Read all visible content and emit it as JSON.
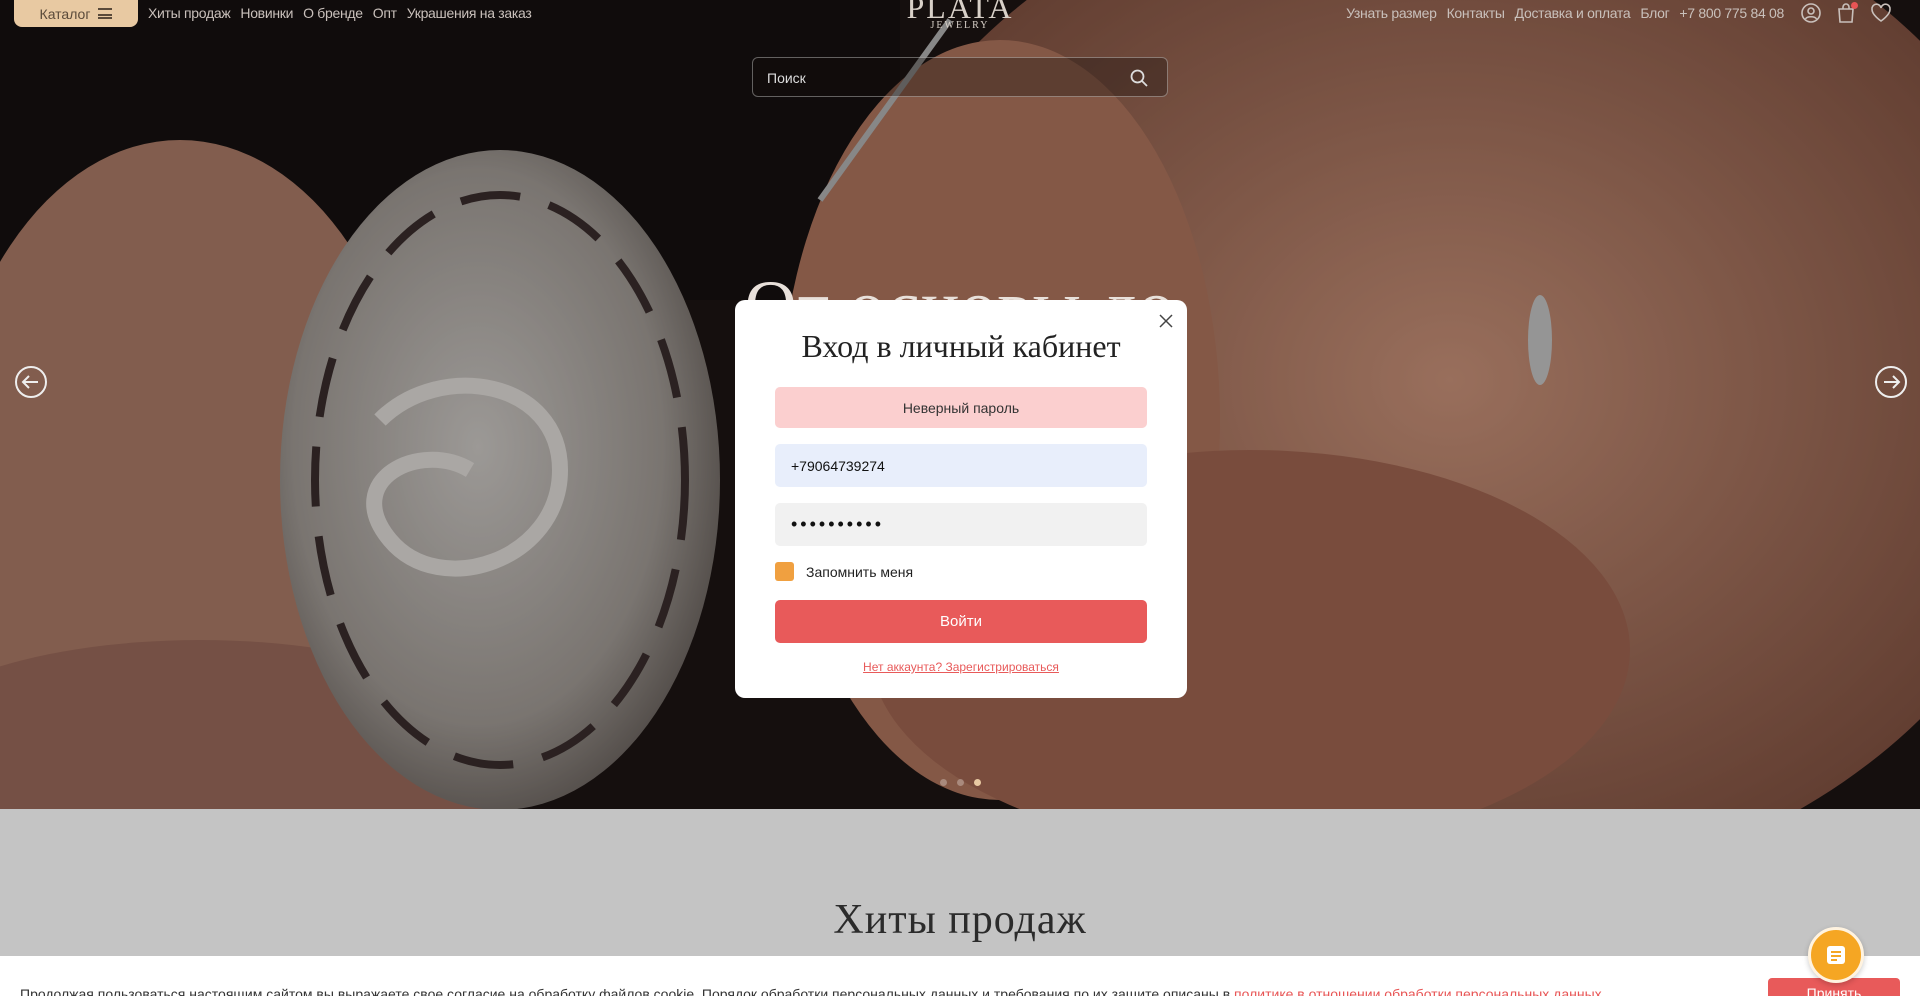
{
  "header": {
    "catalog_label": "Каталог",
    "nav_left": [
      "Хиты продаж",
      "Новинки",
      "О бренде",
      "Опт",
      "Украшения на заказ"
    ],
    "nav_right": [
      "Узнать размер",
      "Контакты",
      "Доставка и оплата",
      "Блог",
      "+7 800 775 84 08"
    ],
    "logo_main": "PLATA",
    "logo_sub": "JEWELRY",
    "icons": [
      "user-icon",
      "cart-icon",
      "heart-icon"
    ]
  },
  "search": {
    "placeholder": "Поиск"
  },
  "hero": {
    "title": "От основы до"
  },
  "login_modal": {
    "title": "Вход в личный кабинет",
    "error": "Неверный пароль",
    "phone_value": "+79064739274",
    "password_value": "••••••••••",
    "remember_label": "Запомнить меня",
    "submit_label": "Войти",
    "register_link": "Нет аккаунта? Зарегистрироваться"
  },
  "bestsellers": {
    "title": "Хиты продаж"
  },
  "cookie": {
    "text": "Продолжая пользоваться настоящим сайтом вы выражаете свое согласие на обработку файлов cookie. Порядок обработки персональных данных и требования по их защите описаны в ",
    "link": "политике в отношении обработки персональных данных",
    "button": "Принять"
  },
  "colors": {
    "accent": "#e85a5a",
    "catalog_bg": "#e8c9a2",
    "checkbox": "#f0a040",
    "chat": "#f5a623",
    "error_bg": "#fbcfcf"
  }
}
